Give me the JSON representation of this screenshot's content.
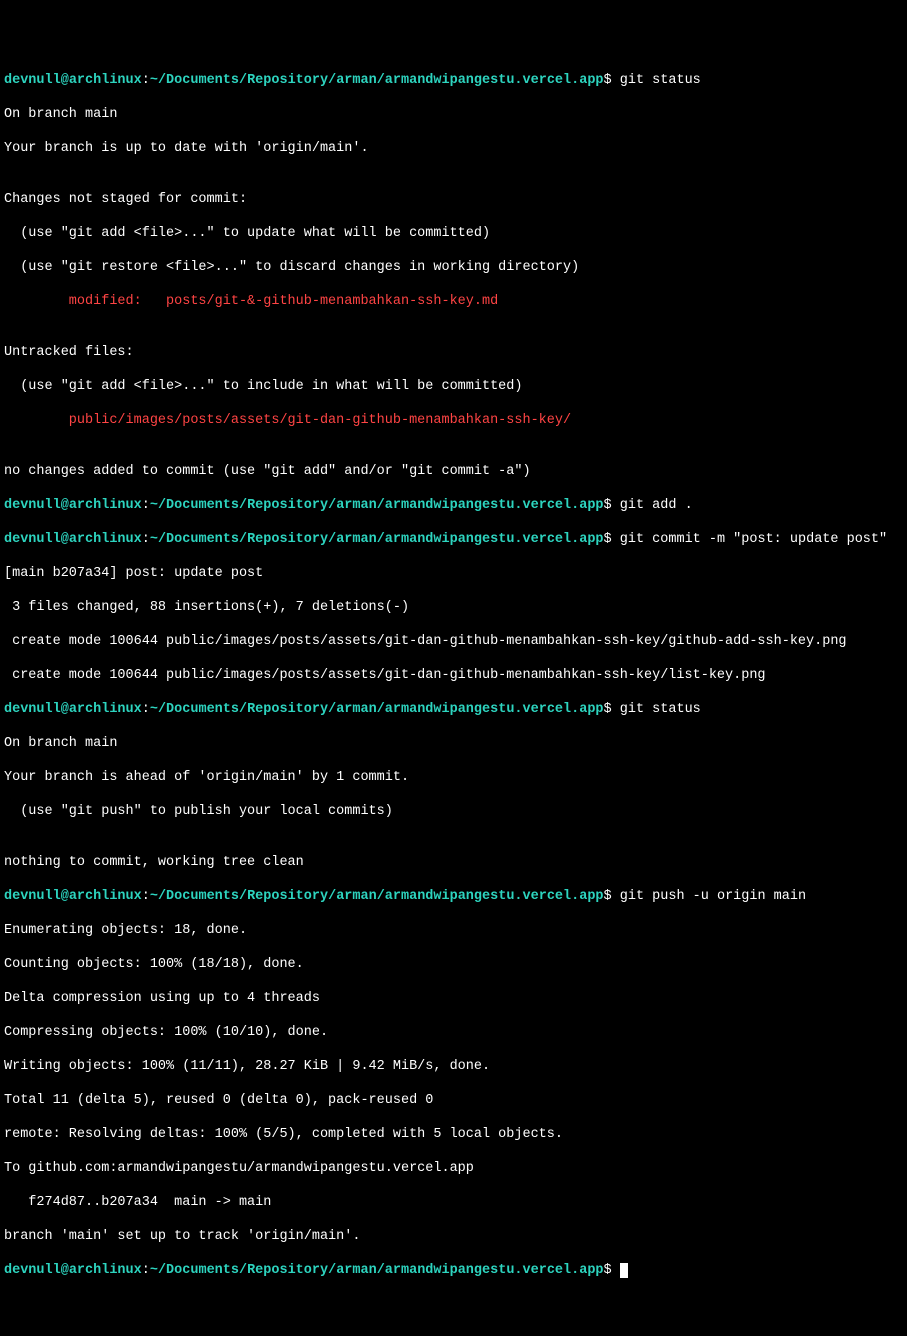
{
  "prompt": {
    "user": "devnull",
    "at": "@",
    "host": "archlinux",
    "colon": ":",
    "path": "~/Documents/Repository/arman/armandwipangestu.vercel.app",
    "dollar": "$"
  },
  "lines": {
    "cmd1": " git status",
    "l1": "On branch main",
    "l2": "Your branch is up to date with 'origin/main'.",
    "l3": "",
    "l4": "Changes not staged for commit:",
    "l5": "  (use \"git add <file>...\" to update what will be committed)",
    "l6": "  (use \"git restore <file>...\" to discard changes in working directory)",
    "l7": "        modified:   posts/git-&-github-menambahkan-ssh-key.md",
    "l8": "",
    "l9": "Untracked files:",
    "l10": "  (use \"git add <file>...\" to include in what will be committed)",
    "l11": "        public/images/posts/assets/git-dan-github-menambahkan-ssh-key/",
    "l12": "",
    "l13": "no changes added to commit (use \"git add\" and/or \"git commit -a\")",
    "cmd2": " git add .",
    "cmd3": " git commit -m \"post: update post\"",
    "l14": "[main b207a34] post: update post",
    "l15": " 3 files changed, 88 insertions(+), 7 deletions(-)",
    "l16": " create mode 100644 public/images/posts/assets/git-dan-github-menambahkan-ssh-key/github-add-ssh-key.png",
    "l17": " create mode 100644 public/images/posts/assets/git-dan-github-menambahkan-ssh-key/list-key.png",
    "cmd4": " git status",
    "l18": "On branch main",
    "l19": "Your branch is ahead of 'origin/main' by 1 commit.",
    "l20": "  (use \"git push\" to publish your local commits)",
    "l21": "",
    "l22": "nothing to commit, working tree clean",
    "cmd5": " git push -u origin main",
    "l23": "Enumerating objects: 18, done.",
    "l24": "Counting objects: 100% (18/18), done.",
    "l25": "Delta compression using up to 4 threads",
    "l26": "Compressing objects: 100% (10/10), done.",
    "l27": "Writing objects: 100% (11/11), 28.27 KiB | 9.42 MiB/s, done.",
    "l28": "Total 11 (delta 5), reused 0 (delta 0), pack-reused 0",
    "l29": "remote: Resolving deltas: 100% (5/5), completed with 5 local objects.",
    "l30": "To github.com:armandwipangestu/armandwipangestu.vercel.app",
    "l31": "   f274d87..b207a34  main -> main",
    "l32": "branch 'main' set up to track 'origin/main'.",
    "cmd6": " "
  }
}
